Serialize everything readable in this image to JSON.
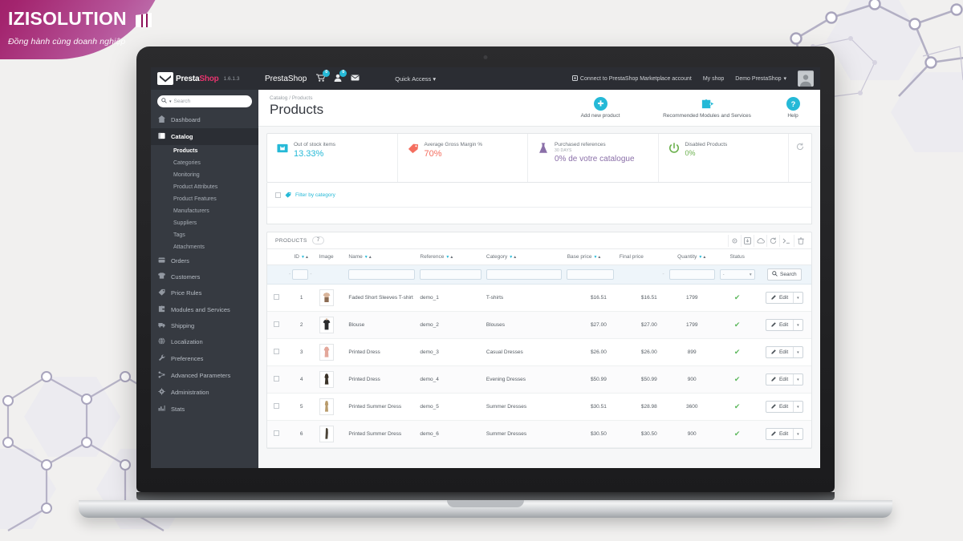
{
  "brand": {
    "title": "IZISOLUTION",
    "tagline": "Đồng hành cùng doanh nghiệp",
    "mark_icon": "flag-mark-icon",
    "color": "#8d1159"
  },
  "header": {
    "logo_icon": "prestashop-logo-icon",
    "logo_text_1": "Presta",
    "logo_text_2": "Shop",
    "version": "1.6.1.3",
    "shop_name": "PrestaShop",
    "icons": [
      {
        "name": "cart-icon",
        "glyph": "🛒",
        "badge": "0"
      },
      {
        "name": "customer-icon",
        "glyph": "👤",
        "badge": "0"
      },
      {
        "name": "mail-icon",
        "glyph": "✉",
        "badge": ""
      }
    ],
    "quick_access": "Quick Access",
    "marketplace_link": "Connect to PrestaShop Marketplace account",
    "my_shop": "My shop",
    "account": "Demo PrestaShop",
    "avatar_icon": "user-avatar"
  },
  "sidebar": {
    "search_placeholder": "Search",
    "search_icon": "search-icon",
    "items": [
      {
        "label": "Dashboard",
        "icon": "dashboard-icon",
        "glyph": "⌂",
        "active": false
      },
      {
        "label": "Catalog",
        "icon": "catalog-icon",
        "glyph": "📕",
        "active": true
      },
      {
        "label": "Orders",
        "icon": "orders-icon",
        "glyph": "💳",
        "active": false
      },
      {
        "label": "Customers",
        "icon": "customers-icon",
        "glyph": "👕",
        "active": false
      },
      {
        "label": "Price Rules",
        "icon": "price-rules-icon",
        "glyph": "🏷",
        "active": false
      },
      {
        "label": "Modules and Services",
        "icon": "modules-icon",
        "glyph": "⚙",
        "active": false
      },
      {
        "label": "Shipping",
        "icon": "shipping-icon",
        "glyph": "🚚",
        "active": false
      },
      {
        "label": "Localization",
        "icon": "localization-icon",
        "glyph": "🌐",
        "active": false
      },
      {
        "label": "Preferences",
        "icon": "preferences-icon",
        "glyph": "🔧",
        "active": false
      },
      {
        "label": "Advanced Parameters",
        "icon": "advanced-parameters-icon",
        "glyph": "☲",
        "active": false
      },
      {
        "label": "Administration",
        "icon": "administration-icon",
        "glyph": "⚙",
        "active": false
      },
      {
        "label": "Stats",
        "icon": "stats-icon",
        "glyph": "📊",
        "active": false
      }
    ],
    "catalog_subitems": [
      {
        "label": "Products",
        "active": true
      },
      {
        "label": "Categories",
        "active": false
      },
      {
        "label": "Monitoring",
        "active": false
      },
      {
        "label": "Product Attributes",
        "active": false
      },
      {
        "label": "Product Features",
        "active": false
      },
      {
        "label": "Manufacturers",
        "active": false
      },
      {
        "label": "Suppliers",
        "active": false
      },
      {
        "label": "Tags",
        "active": false
      },
      {
        "label": "Attachments",
        "active": false
      }
    ]
  },
  "page": {
    "breadcrumb": "Catalog / Products",
    "title": "Products",
    "actions": [
      {
        "label": "Add new product",
        "icon": "plus-icon",
        "glyph": "+"
      },
      {
        "label": "Recommended Modules and Services",
        "icon": "puzzle-icon",
        "glyph": "❖"
      },
      {
        "label": "Help",
        "icon": "help-icon",
        "glyph": "?"
      }
    ]
  },
  "kpis": [
    {
      "title": "Out of stock items",
      "sub": "",
      "value": "13.33%",
      "color": "#25b9d7",
      "icon": "box-icon",
      "glyph": "▣"
    },
    {
      "title": "Average Gross Margin %",
      "sub": "",
      "value": "70%",
      "color": "#f46e5f",
      "icon": "tag-icon",
      "glyph": "🏷"
    },
    {
      "title": "Purchased references",
      "sub": "30 DAYS",
      "value": "0% de votre catalogue",
      "color": "#8a6fa8",
      "icon": "flask-icon",
      "glyph": "⚗"
    },
    {
      "title": "Disabled Products",
      "sub": "",
      "value": "0%",
      "color": "#6ab04c",
      "icon": "power-icon",
      "glyph": "⏻"
    }
  ],
  "kpi_refresh_icon": "refresh-icon",
  "filter": {
    "label": "Filter by category",
    "tag_icon": "tag-icon",
    "checkbox_icon": "checkbox-icon"
  },
  "table": {
    "title": "PRODUCTS",
    "count": "7",
    "tools": [
      {
        "name": "settings-icon",
        "glyph": "⚙"
      },
      {
        "name": "export-icon",
        "glyph": "⬒"
      },
      {
        "name": "import-icon",
        "glyph": "☁"
      },
      {
        "name": "refresh-icon",
        "glyph": "⟳"
      },
      {
        "name": "console-icon",
        "glyph": "〉_"
      },
      {
        "name": "delete-icon",
        "glyph": "🗑"
      }
    ],
    "columns": [
      {
        "label": "",
        "key": "chk"
      },
      {
        "label": "ID",
        "key": "id",
        "sortable": true
      },
      {
        "label": "Image",
        "key": "image",
        "sortable": false
      },
      {
        "label": "Name",
        "key": "name",
        "sortable": true
      },
      {
        "label": "Reference",
        "key": "reference",
        "sortable": true
      },
      {
        "label": "Category",
        "key": "category",
        "sortable": true
      },
      {
        "label": "Base price",
        "key": "base_price",
        "sortable": true
      },
      {
        "label": "Final price",
        "key": "final_price",
        "sortable": false
      },
      {
        "label": "Quantity",
        "key": "quantity",
        "sortable": true
      },
      {
        "label": "Status",
        "key": "status",
        "sortable": false
      },
      {
        "label": "",
        "key": "actions"
      }
    ],
    "filter_row": {
      "id_from": "",
      "id_to": "",
      "name": "",
      "reference": "",
      "category": "",
      "base_price_from": "",
      "base_price_to": "",
      "quantity": "",
      "status_selected": "-",
      "search_label": "Search",
      "search_icon": "search-icon"
    },
    "rows": [
      {
        "id": "1",
        "name": "Faded Short Sleeves T-shirt",
        "reference": "demo_1",
        "category": "T-shirts",
        "base_price": "$16.51",
        "final_price": "$16.51",
        "quantity": "1799",
        "status": "enabled",
        "thumb": "tshirt-thumb",
        "edit_label": "Edit"
      },
      {
        "id": "2",
        "name": "Blouse",
        "reference": "demo_2",
        "category": "Blouses",
        "base_price": "$27.00",
        "final_price": "$27.00",
        "quantity": "1799",
        "status": "enabled",
        "thumb": "blouse-thumb",
        "edit_label": "Edit"
      },
      {
        "id": "3",
        "name": "Printed Dress",
        "reference": "demo_3",
        "category": "Casual Dresses",
        "base_price": "$26.00",
        "final_price": "$26.00",
        "quantity": "899",
        "status": "enabled",
        "thumb": "dress-thumb",
        "edit_label": "Edit"
      },
      {
        "id": "4",
        "name": "Printed Dress",
        "reference": "demo_4",
        "category": "Evening Dresses",
        "base_price": "$50.99",
        "final_price": "$50.99",
        "quantity": "900",
        "status": "enabled",
        "thumb": "dress-thumb",
        "edit_label": "Edit"
      },
      {
        "id": "5",
        "name": "Printed Summer Dress",
        "reference": "demo_5",
        "category": "Summer Dresses",
        "base_price": "$30.51",
        "final_price": "$28.98",
        "quantity": "3600",
        "status": "enabled",
        "thumb": "dress-thumb",
        "edit_label": "Edit"
      },
      {
        "id": "6",
        "name": "Printed Summer Dress",
        "reference": "demo_6",
        "category": "Summer Dresses",
        "base_price": "$30.50",
        "final_price": "$30.50",
        "quantity": "900",
        "status": "enabled",
        "thumb": "dress-thumb",
        "edit_label": "Edit"
      }
    ],
    "edit_caret": "▾",
    "status_enabled_icon": "check-icon",
    "edit_icon": "pencil-icon"
  }
}
